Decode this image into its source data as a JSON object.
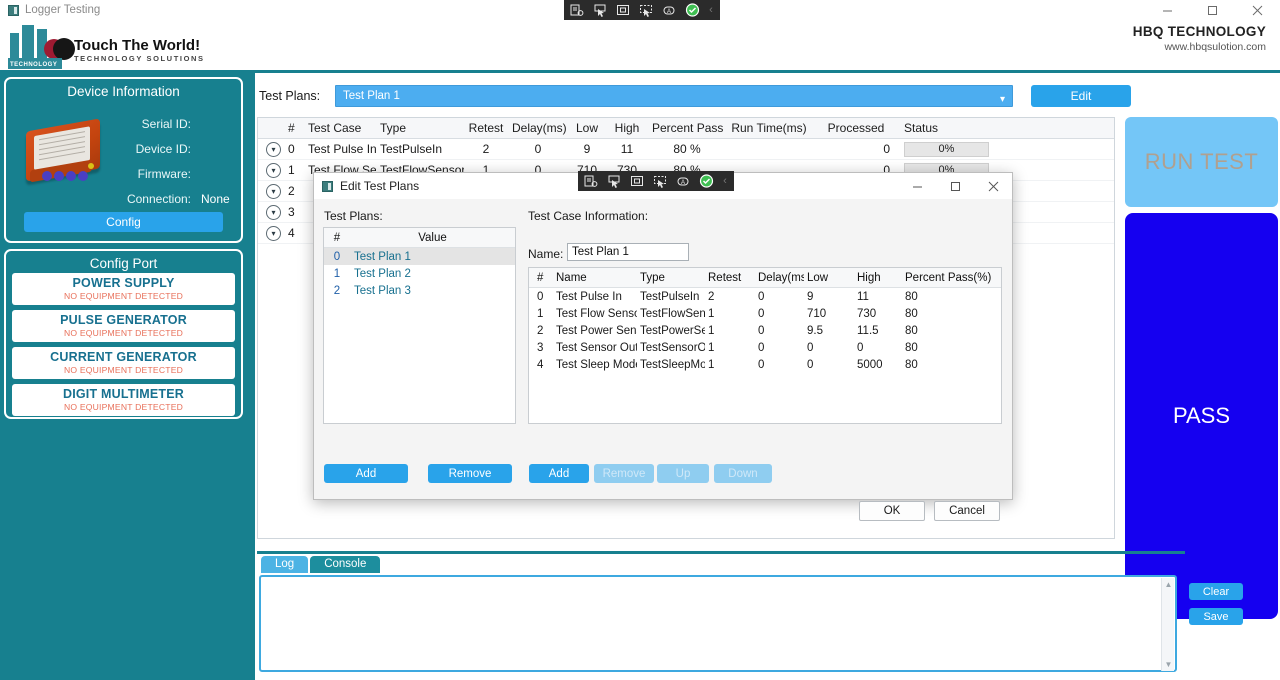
{
  "os_window": {
    "title": "Logger Testing",
    "icon": "app-icon",
    "controls": {
      "minimize": "minimize-icon",
      "maximize": "maximize-icon",
      "close": "close-icon"
    }
  },
  "capture_toolbar": {
    "items": [
      "capture-settings-icon",
      "cursor-capture-icon",
      "region-capture-icon",
      "window-capture-icon",
      "record-icon",
      "confirm-icon"
    ],
    "collapse": "‹"
  },
  "brand": {
    "logo_title": "Touch The World!",
    "logo_subtitle": "TECHNOLOGY SOLUTIONS",
    "logo_base_text": "TECHNOLOGY",
    "company": "HBQ TECHNOLOGY",
    "website": "www.hbqsulotion.com",
    "accent": "#17808f"
  },
  "sidebar": {
    "device_panel": {
      "title": "Device Information",
      "fields": [
        {
          "label": "Serial ID:",
          "value": ""
        },
        {
          "label": "Device ID:",
          "value": ""
        },
        {
          "label": "Firmware:",
          "value": ""
        },
        {
          "label": "Connection:",
          "value": "None"
        }
      ],
      "config_button": "Config"
    },
    "config_port": {
      "title": "Config Port",
      "equipment": [
        {
          "name": "POWER SUPPLY",
          "status": "NO EQUIPMENT DETECTED"
        },
        {
          "name": "PULSE GENERATOR",
          "status": "NO EQUIPMENT DETECTED"
        },
        {
          "name": "CURRENT GENERATOR",
          "status": "NO EQUIPMENT DETECTED"
        },
        {
          "name": "DIGIT MULTIMETER",
          "status": "NO EQUIPMENT DETECTED"
        }
      ],
      "name_color": "#17708f",
      "status_color": "#e8705a"
    }
  },
  "main": {
    "test_plans_label": "Test Plans:",
    "selected_plan": "Test Plan 1",
    "edit_button": "Edit",
    "grid": {
      "headers": [
        "#",
        "Test Case",
        "Type",
        "Retest",
        "Delay(ms)",
        "Low",
        "High",
        "Percent Pass",
        "Run Time(ms)",
        "Processed",
        "Status"
      ],
      "rows": [
        {
          "idx": "0",
          "case": "Test Pulse In",
          "type": "TestPulseIn",
          "retest": "2",
          "delay": "0",
          "low": "9",
          "high": "11",
          "pct": "80 %",
          "runtime": "",
          "processed": "0",
          "progress": "0%",
          "status": ""
        },
        {
          "idx": "1",
          "case": "Test Flow Sensor",
          "type": "TestFlowSensor",
          "retest": "1",
          "delay": "0",
          "low": "710",
          "high": "730",
          "pct": "80 %",
          "runtime": "",
          "processed": "0",
          "progress": "0%",
          "status": ""
        },
        {
          "idx": "2",
          "case": "",
          "type": "",
          "retest": "",
          "delay": "",
          "low": "",
          "high": "",
          "pct": "",
          "runtime": "",
          "processed": "",
          "progress": "",
          "status": ""
        },
        {
          "idx": "3",
          "case": "",
          "type": "",
          "retest": "",
          "delay": "",
          "low": "",
          "high": "",
          "pct": "",
          "runtime": "",
          "processed": "",
          "progress": "",
          "status": ""
        },
        {
          "idx": "4",
          "case": "",
          "type": "",
          "retest": "",
          "delay": "",
          "low": "",
          "high": "",
          "pct": "",
          "runtime": "",
          "processed": "",
          "progress": "",
          "status": ""
        }
      ]
    },
    "run_button": "RUN TEST",
    "result": "PASS",
    "result_color": "#1500f0",
    "log": {
      "tabs": [
        {
          "label": "Log",
          "active": true
        },
        {
          "label": "Console",
          "active": false
        }
      ],
      "content": "",
      "clear_button": "Clear",
      "save_button": "Save"
    }
  },
  "dialog": {
    "title": "Edit Test Plans",
    "controls": {
      "minimize": "minimize-icon",
      "maximize": "maximize-icon",
      "close": "close-icon"
    },
    "plans_label": "Test Plans:",
    "plans_headers": [
      "#",
      "Value"
    ],
    "plans": [
      {
        "idx": "0",
        "value": "Test Plan 1",
        "selected": true
      },
      {
        "idx": "1",
        "value": "Test Plan 2",
        "selected": false
      },
      {
        "idx": "2",
        "value": "Test Plan 3",
        "selected": false
      }
    ],
    "case_info_label": "Test Case Information:",
    "name_label": "Name:",
    "name_value": "Test Plan 1",
    "case_headers": [
      "#",
      "Name",
      "Type",
      "Retest",
      "Delay(ms",
      "Low",
      "High",
      "Percent Pass(%)"
    ],
    "cases": [
      {
        "idx": "0",
        "name": "Test Pulse In",
        "type": "TestPulseIn",
        "retest": "2",
        "delay": "0",
        "low": "9",
        "high": "11",
        "pct": "80"
      },
      {
        "idx": "1",
        "name": "Test Flow Sensor",
        "type": "TestFlowSensor",
        "retest": "1",
        "delay": "0",
        "low": "710",
        "high": "730",
        "pct": "80"
      },
      {
        "idx": "2",
        "name": "Test Power Sensor",
        "type": "TestPowerSenso",
        "retest": "1",
        "delay": "0",
        "low": "9.5",
        "high": "11.5",
        "pct": "80"
      },
      {
        "idx": "3",
        "name": "Test Sensor Out",
        "type": "TestSensorOut",
        "retest": "1",
        "delay": "0",
        "low": "0",
        "high": "0",
        "pct": "80"
      },
      {
        "idx": "4",
        "name": "Test Sleep Mode",
        "type": "TestSleepMode",
        "retest": "1",
        "delay": "0",
        "low": "0",
        "high": "5000",
        "pct": "80"
      }
    ],
    "buttons": {
      "plan_add": "Add",
      "plan_remove": "Remove",
      "case_add": "Add",
      "case_remove": "Remove",
      "case_up": "Up",
      "case_down": "Down",
      "ok": "OK",
      "cancel": "Cancel"
    }
  }
}
